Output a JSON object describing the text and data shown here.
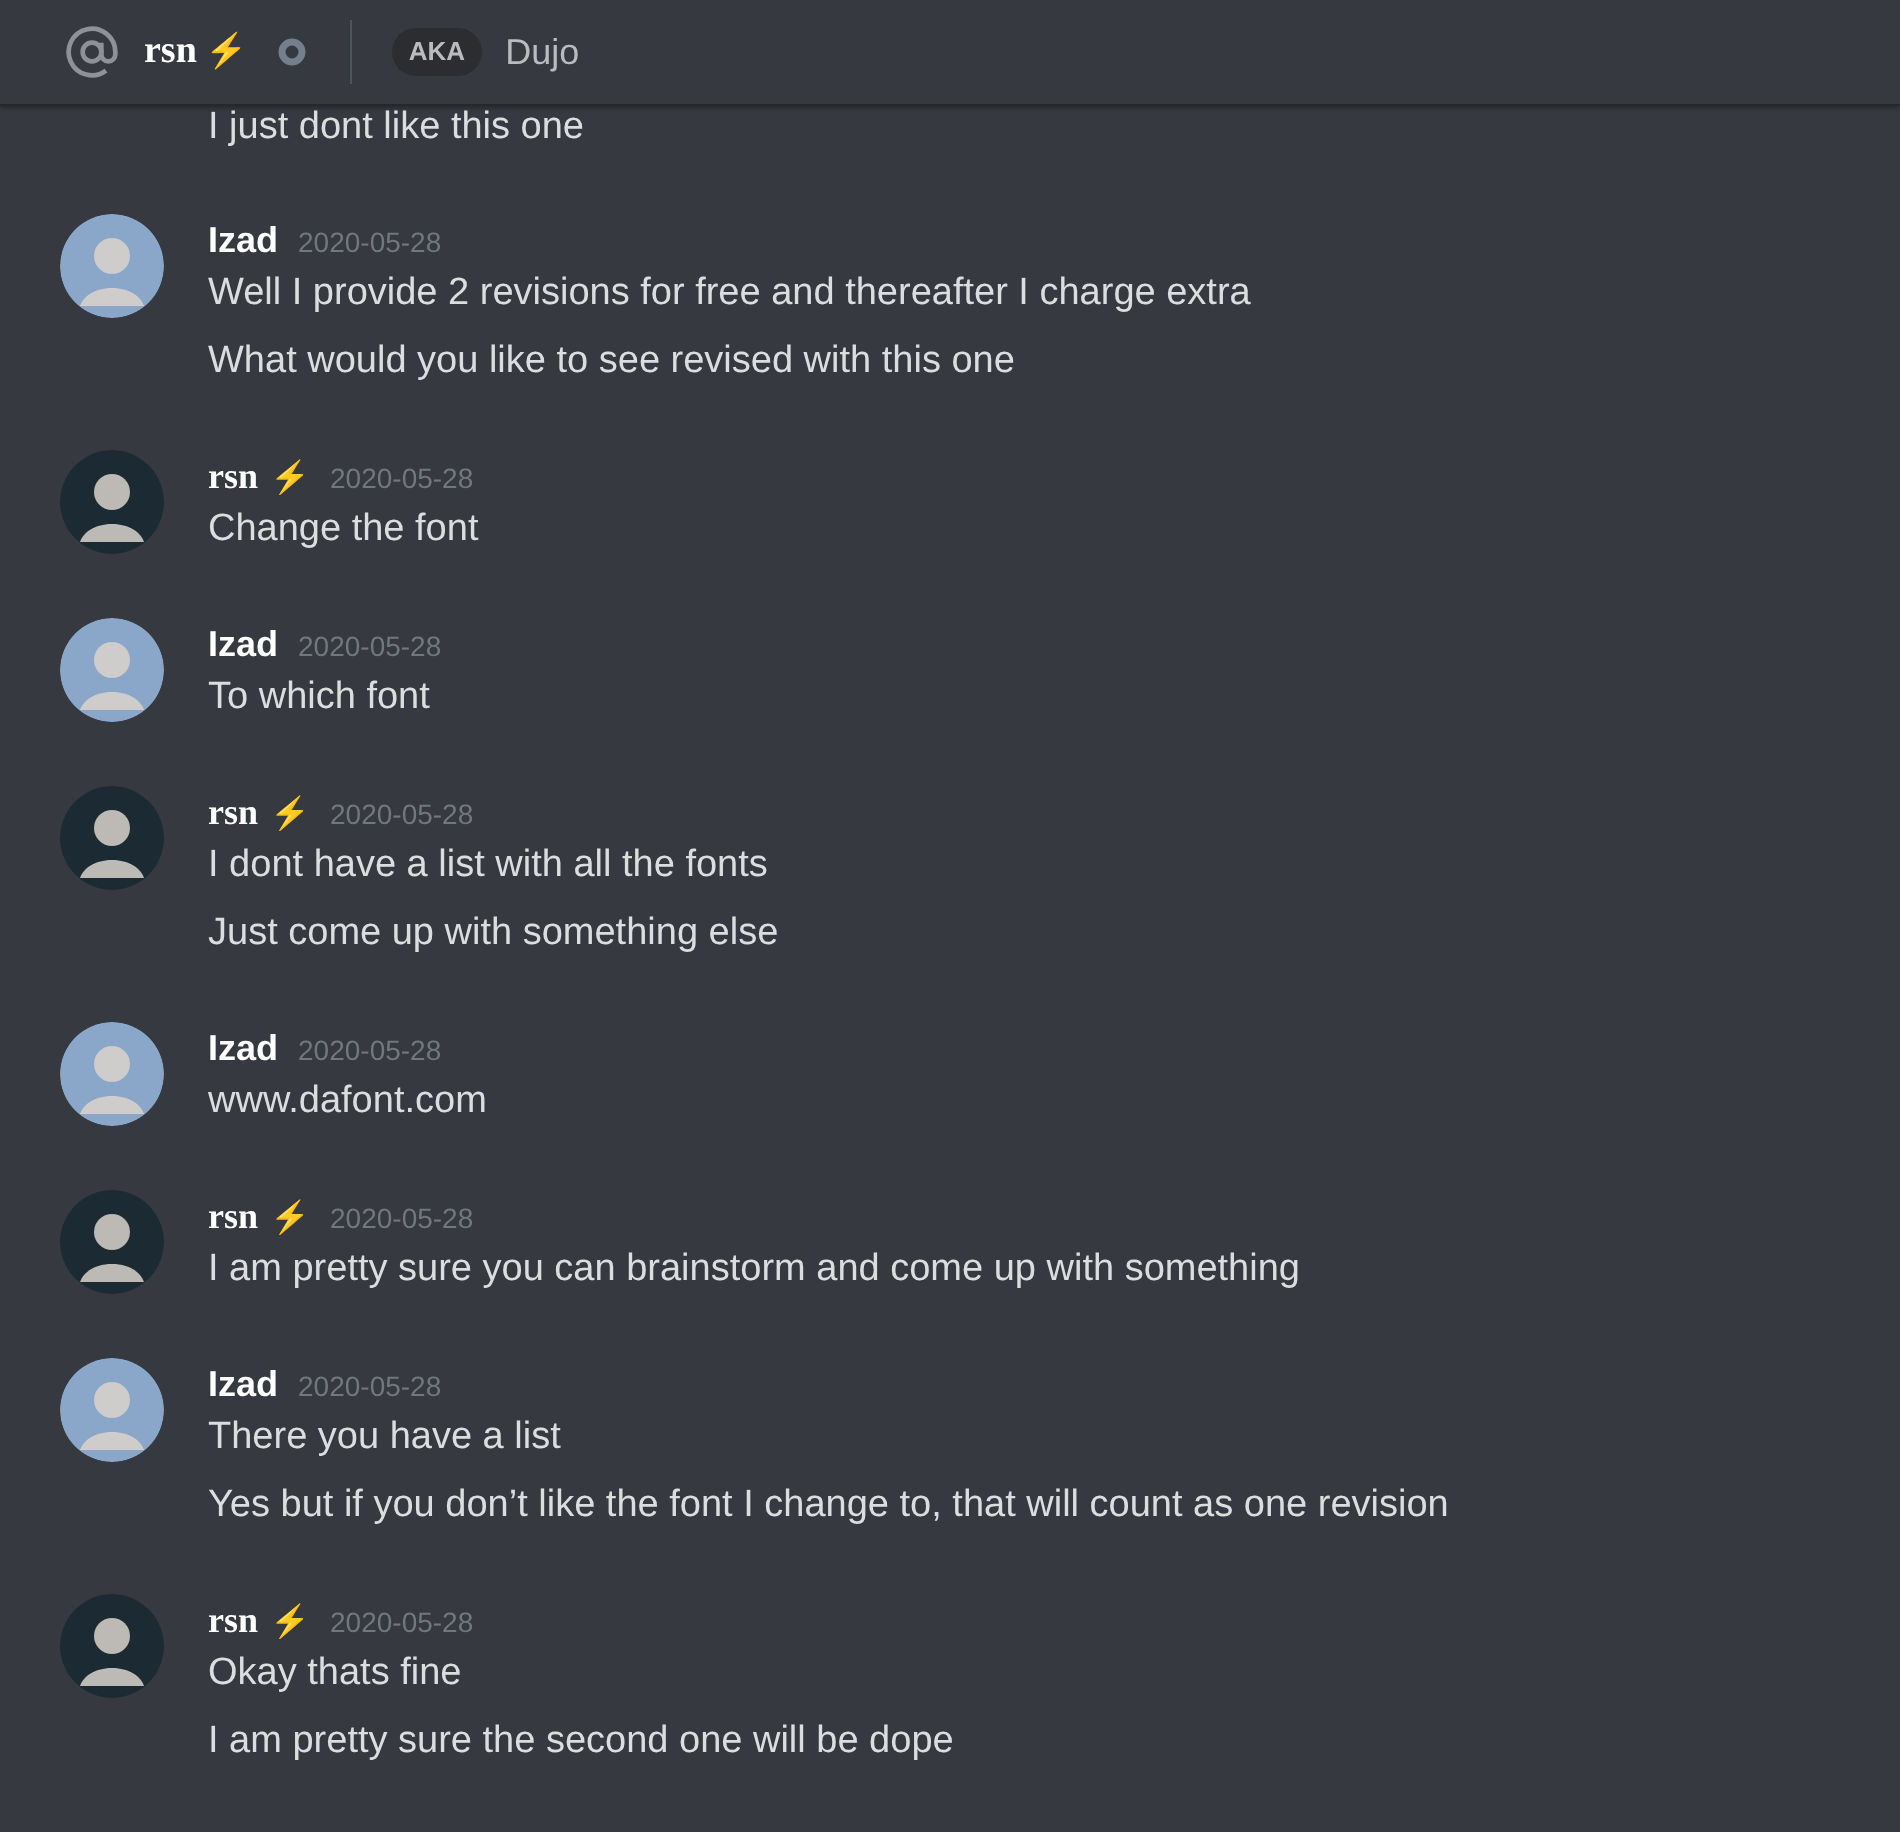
{
  "header": {
    "name": "rsn",
    "badge": "⚡",
    "aka_label": "AKA",
    "nickname": "Dujo"
  },
  "cut_line": "I just dont like this one",
  "messages": [
    {
      "author": "Izad",
      "kind": "sans",
      "color": "#8aa6c8",
      "time": "2020-05-28",
      "lines": [
        "Well I provide 2 revisions for free and thereafter I charge extra",
        "What would you like to see revised with this one"
      ]
    },
    {
      "author": "rsn",
      "badge": "⚡",
      "kind": "serif",
      "color": "#1c2a33",
      "time": "2020-05-28",
      "lines": [
        "Change the font"
      ]
    },
    {
      "author": "Izad",
      "kind": "sans",
      "color": "#8aa6c8",
      "time": "2020-05-28",
      "lines": [
        "To which font"
      ]
    },
    {
      "author": "rsn",
      "badge": "⚡",
      "kind": "serif",
      "color": "#1c2a33",
      "time": "2020-05-28",
      "lines": [
        "I dont have a list with all the fonts",
        "Just come up with something else"
      ]
    },
    {
      "author": "Izad",
      "kind": "sans",
      "color": "#8aa6c8",
      "time": "2020-05-28",
      "lines": [
        "www.dafont.com"
      ]
    },
    {
      "author": "rsn",
      "badge": "⚡",
      "kind": "serif",
      "color": "#1c2a33",
      "time": "2020-05-28",
      "lines": [
        "I am pretty sure you can brainstorm and come up with something"
      ]
    },
    {
      "author": "Izad",
      "kind": "sans",
      "color": "#8aa6c8",
      "time": "2020-05-28",
      "lines": [
        "There you have a list",
        "Yes but if you don’t like the font I change to, that will count as one revision"
      ]
    },
    {
      "author": "rsn",
      "badge": "⚡",
      "kind": "serif",
      "color": "#1c2a33",
      "time": "2020-05-28",
      "lines": [
        "Okay thats fine",
        "I am pretty sure the second one will be dope"
      ]
    }
  ]
}
